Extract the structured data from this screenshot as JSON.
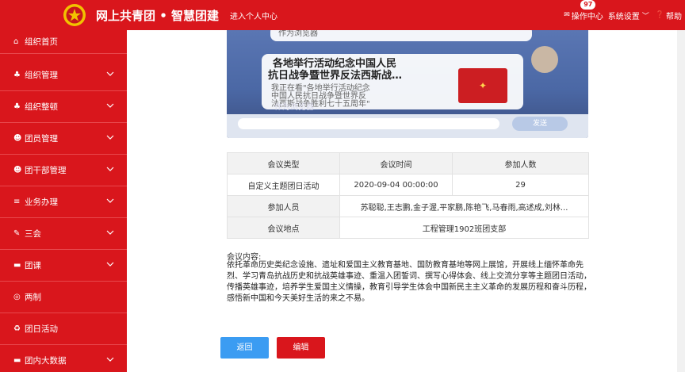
{
  "header": {
    "brand": "网上共青团 • 智慧团建",
    "enter_center": "进入个人中心",
    "operation_center": "操作中心",
    "badge": "97",
    "system_settings": "系统设置",
    "help": "帮助"
  },
  "sidebar": {
    "items": [
      {
        "icon": "home-icon",
        "label": "组织首页"
      },
      {
        "icon": "org-tree-icon",
        "label": "组织管理"
      },
      {
        "icon": "org-tree-icon",
        "label": "组织整顿"
      },
      {
        "icon": "members-icon",
        "label": "团员管理"
      },
      {
        "icon": "members-icon",
        "label": "团干部管理"
      },
      {
        "icon": "list-icon",
        "label": "业务办理"
      },
      {
        "icon": "edit-box-icon",
        "label": "三会"
      },
      {
        "icon": "folder-icon",
        "label": "团课"
      },
      {
        "icon": "target-icon",
        "label": "两制"
      },
      {
        "icon": "recycle-icon",
        "label": "团日活动"
      },
      {
        "icon": "folder-icon",
        "label": "团内大数据"
      }
    ]
  },
  "media": {
    "top_strip": "作为浏览器",
    "card_title_line1": "各地举行活动纪念中国人民",
    "card_title_line2": "抗日战争暨世界反法西斯战…",
    "card_sub_line1": "我正在看\"各地举行活动纪念",
    "card_sub_line2": "中国人民抗日战争暨世界反",
    "card_sub_line3": "法西斯战争胜利七十五周年\"",
    "card_footer": "作为浏览器",
    "send_label": "发送"
  },
  "table": {
    "headers": [
      "会议类型",
      "会议时间",
      "参加人数"
    ],
    "row1": [
      "自定义主题团日活动",
      "2020-09-04 00:00:00",
      "29"
    ],
    "participants_label": "参加人员",
    "participants_value": "苏聪聪,王志鹏,金子渥,平家鹏,陈艳飞,马春雨,高述成,刘林...",
    "location_label": "会议地点",
    "location_value": "工程管理1902班团支部"
  },
  "content": {
    "label": "会议内容:",
    "body": "依托革命历史类纪念设施、遗址和爱国主义教育基地、国防教育基地等网上展馆，开展线上缅怀革命先烈、学习青岛抗战历史和抗战英雄事迹、重温入团誓词、撰写心得体会、线上交流分享等主题团日活动，传播英雄事迹，培养学生爱国主义情操，教育引导学生体会中国新民主主义革命的发展历程和奋斗历程，感悟新中国和今天美好生活的来之不易。"
  },
  "buttons": {
    "back": "返回",
    "edit": "编辑"
  },
  "colors": {
    "brand_red": "#d9161c",
    "primary_blue": "#3b9cf2"
  }
}
